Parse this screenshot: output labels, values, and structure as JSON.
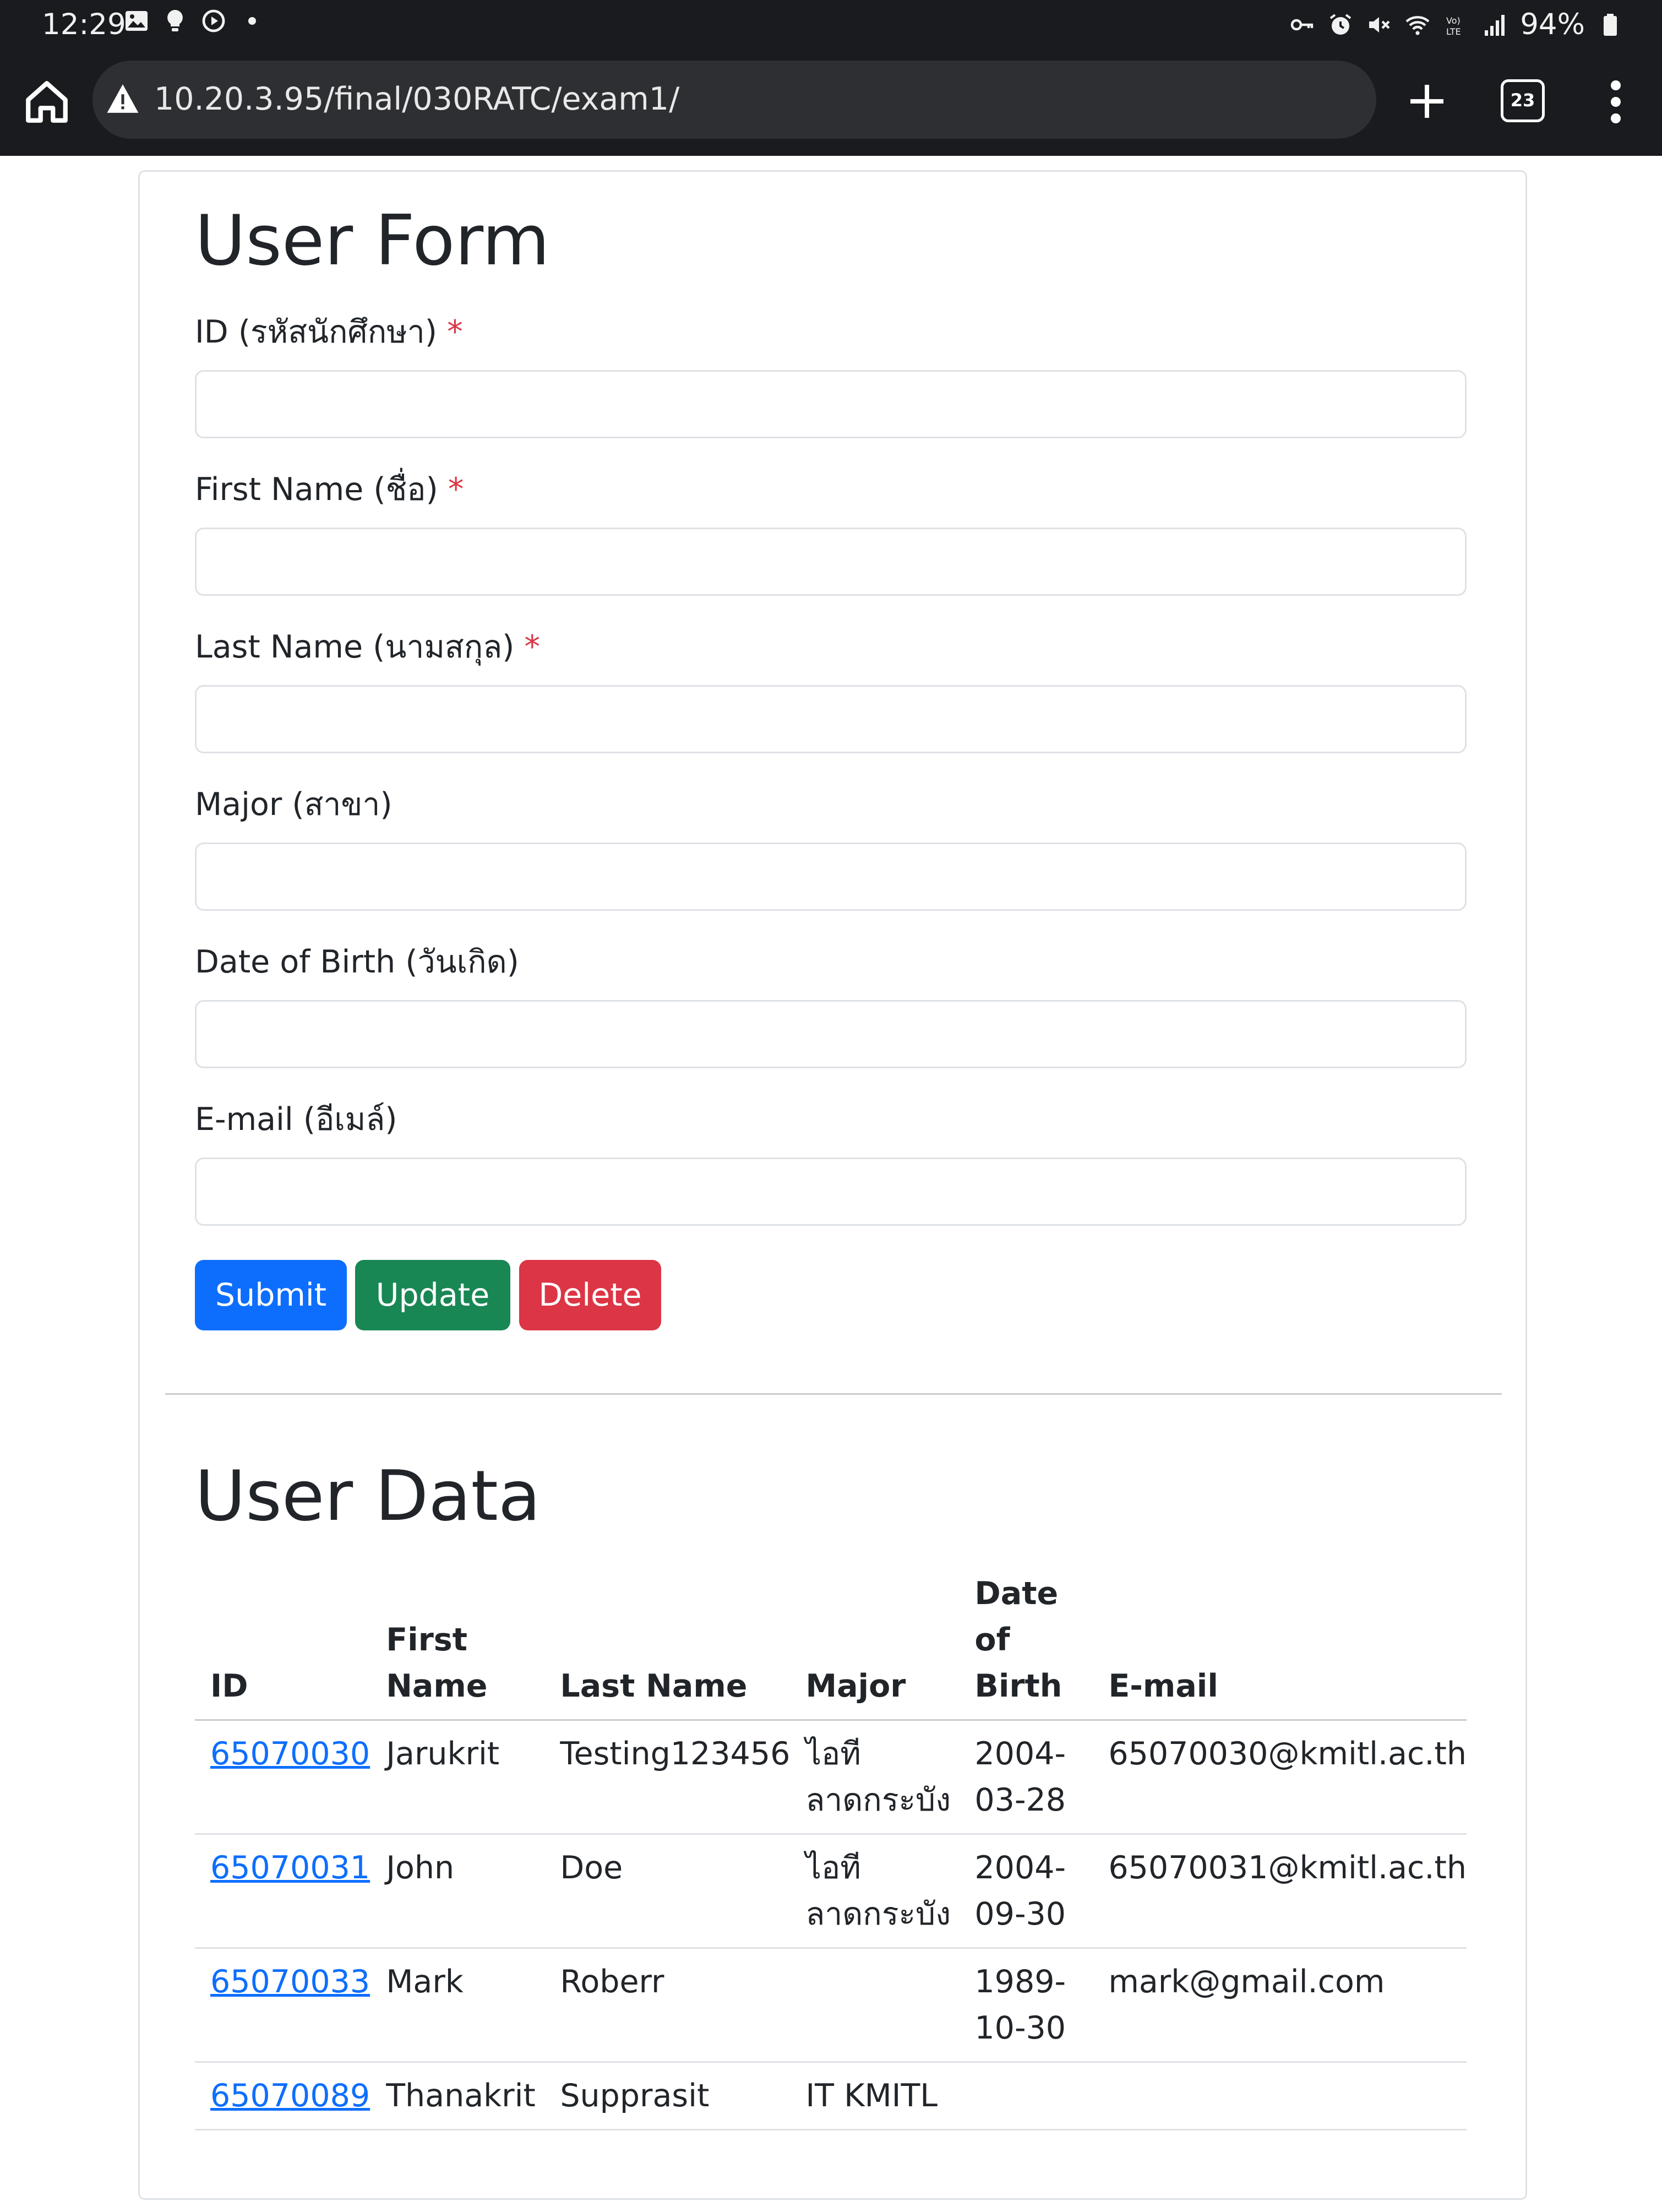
{
  "status_bar": {
    "time": "12:29",
    "battery": "94%",
    "icons_left": [
      "gallery-icon",
      "bulb-icon",
      "play-icon",
      "dot-icon"
    ],
    "icons_right": [
      "vpn-key-icon",
      "alarm-icon",
      "mute-icon",
      "wifi-icon",
      "volte-icon",
      "signal-icon",
      "battery-icon"
    ]
  },
  "browser": {
    "url": "10.20.3.95/final/030RATC/exam1/",
    "tab_count": "23"
  },
  "form": {
    "title": "User Form",
    "fields": [
      {
        "label": "ID (รหัสนักศึกษา)",
        "required_mark": "*",
        "value": ""
      },
      {
        "label": "First Name (ชื่อ)",
        "required_mark": "*",
        "value": ""
      },
      {
        "label": "Last Name (นามสกุล)",
        "required_mark": "*",
        "value": ""
      },
      {
        "label": "Major (สาขา)",
        "required_mark": "",
        "value": ""
      },
      {
        "label": "Date of Birth (วันเกิด)",
        "required_mark": "",
        "value": ""
      },
      {
        "label": "E-mail (อีเมล์)",
        "required_mark": "",
        "value": ""
      }
    ],
    "buttons": {
      "submit": "Submit",
      "update": "Update",
      "delete": "Delete"
    }
  },
  "table": {
    "title": "User Data",
    "headers": {
      "id": "ID",
      "first_name": "First Name",
      "last_name": "Last Name",
      "major": "Major",
      "dob": "Date of Birth",
      "email": "E-mail"
    },
    "rows": [
      {
        "id": "65070030",
        "first": "Jarukrit",
        "last": "Testing123456",
        "major": "ไอที ลาดกระบัง",
        "dob": "2004-03-28",
        "email": "65070030@kmitl.ac.th"
      },
      {
        "id": "65070031",
        "first": "John",
        "last": "Doe",
        "major": "ไอที ลาดกระบัง",
        "dob": "2004-09-30",
        "email": "65070031@kmitl.ac.th"
      },
      {
        "id": "65070033",
        "first": "Mark",
        "last": "Roberr",
        "major": "",
        "dob": "1989-10-30",
        "email": "mark@gmail.com"
      },
      {
        "id": "65070089",
        "first": "Thanakrit",
        "last": "Supprasit",
        "major": "IT KMITL",
        "dob": "",
        "email": ""
      }
    ]
  }
}
